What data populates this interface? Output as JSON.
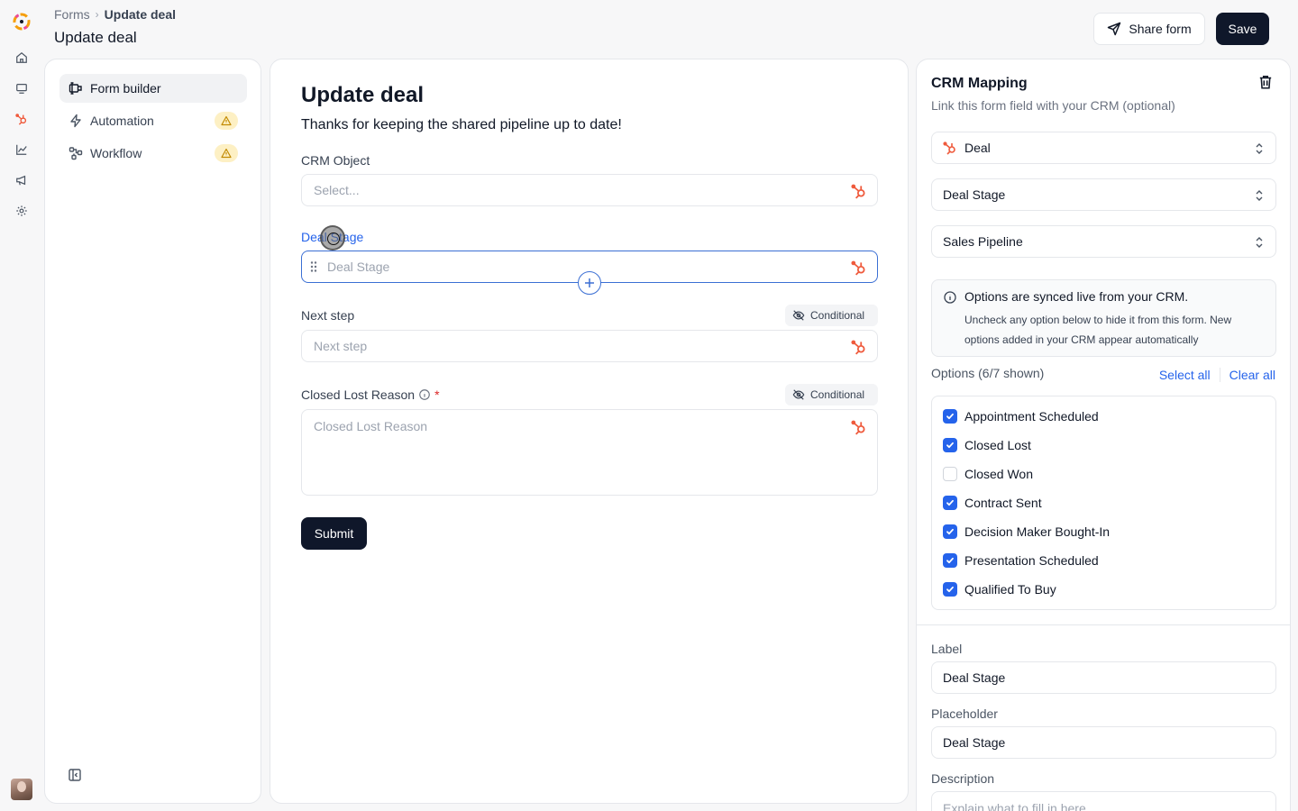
{
  "header": {
    "breadcrumb_root": "Forms",
    "breadcrumb_current": "Update deal",
    "page_title": "Update deal",
    "share_label": "Share form",
    "save_label": "Save"
  },
  "nav": {
    "items": [
      {
        "label": "Form builder",
        "icon": "form-builder-icon",
        "active": true
      },
      {
        "label": "Automation",
        "icon": "bolt-icon",
        "warning": true
      },
      {
        "label": "Workflow",
        "icon": "workflow-icon",
        "warning": true
      }
    ]
  },
  "form": {
    "title": "Update deal",
    "description": "Thanks for keeping the shared pipeline up to date!",
    "fields": [
      {
        "label": "CRM Object",
        "placeholder": "Select..."
      },
      {
        "label": "Deal Stage",
        "placeholder": "Deal Stage"
      },
      {
        "label": "Next step",
        "placeholder": "Next step",
        "badge": "Conditional"
      },
      {
        "label": "Closed Lost Reason",
        "placeholder": "Closed Lost Reason",
        "badge": "Conditional",
        "required_mark": "*"
      }
    ],
    "submit_label": "Submit"
  },
  "crm": {
    "title": "CRM Mapping",
    "subtitle": "Link this form field with your CRM (optional)",
    "object_select": "Deal",
    "property_select": "Deal Stage",
    "pipeline_select": "Sales Pipeline",
    "info_title": "Options are synced live from your CRM.",
    "info_body": "Uncheck any option below to hide it from this form. New options added in your CRM appear automatically",
    "options_header": "Options (6/7 shown)",
    "select_all": "Select all",
    "clear_all": "Clear all",
    "options": [
      {
        "label": "Appointment Scheduled",
        "checked": true
      },
      {
        "label": "Closed Lost",
        "checked": true
      },
      {
        "label": "Closed Won",
        "checked": false
      },
      {
        "label": "Contract Sent",
        "checked": true
      },
      {
        "label": "Decision Maker Bought-In",
        "checked": true
      },
      {
        "label": "Presentation Scheduled",
        "checked": true
      },
      {
        "label": "Qualified To Buy",
        "checked": true
      }
    ],
    "label_title": "Label",
    "label_value": "Deal Stage",
    "placeholder_title": "Placeholder",
    "placeholder_value": "Deal Stage",
    "description_title": "Description",
    "description_placeholder": "Explain what to fill in here"
  },
  "colors": {
    "accent": "#2563eb",
    "primary_button": "#0f172a",
    "hubspot": "#ef5a3c",
    "warning_bg": "#fdf0c4",
    "warning_fg": "#c28a00"
  }
}
